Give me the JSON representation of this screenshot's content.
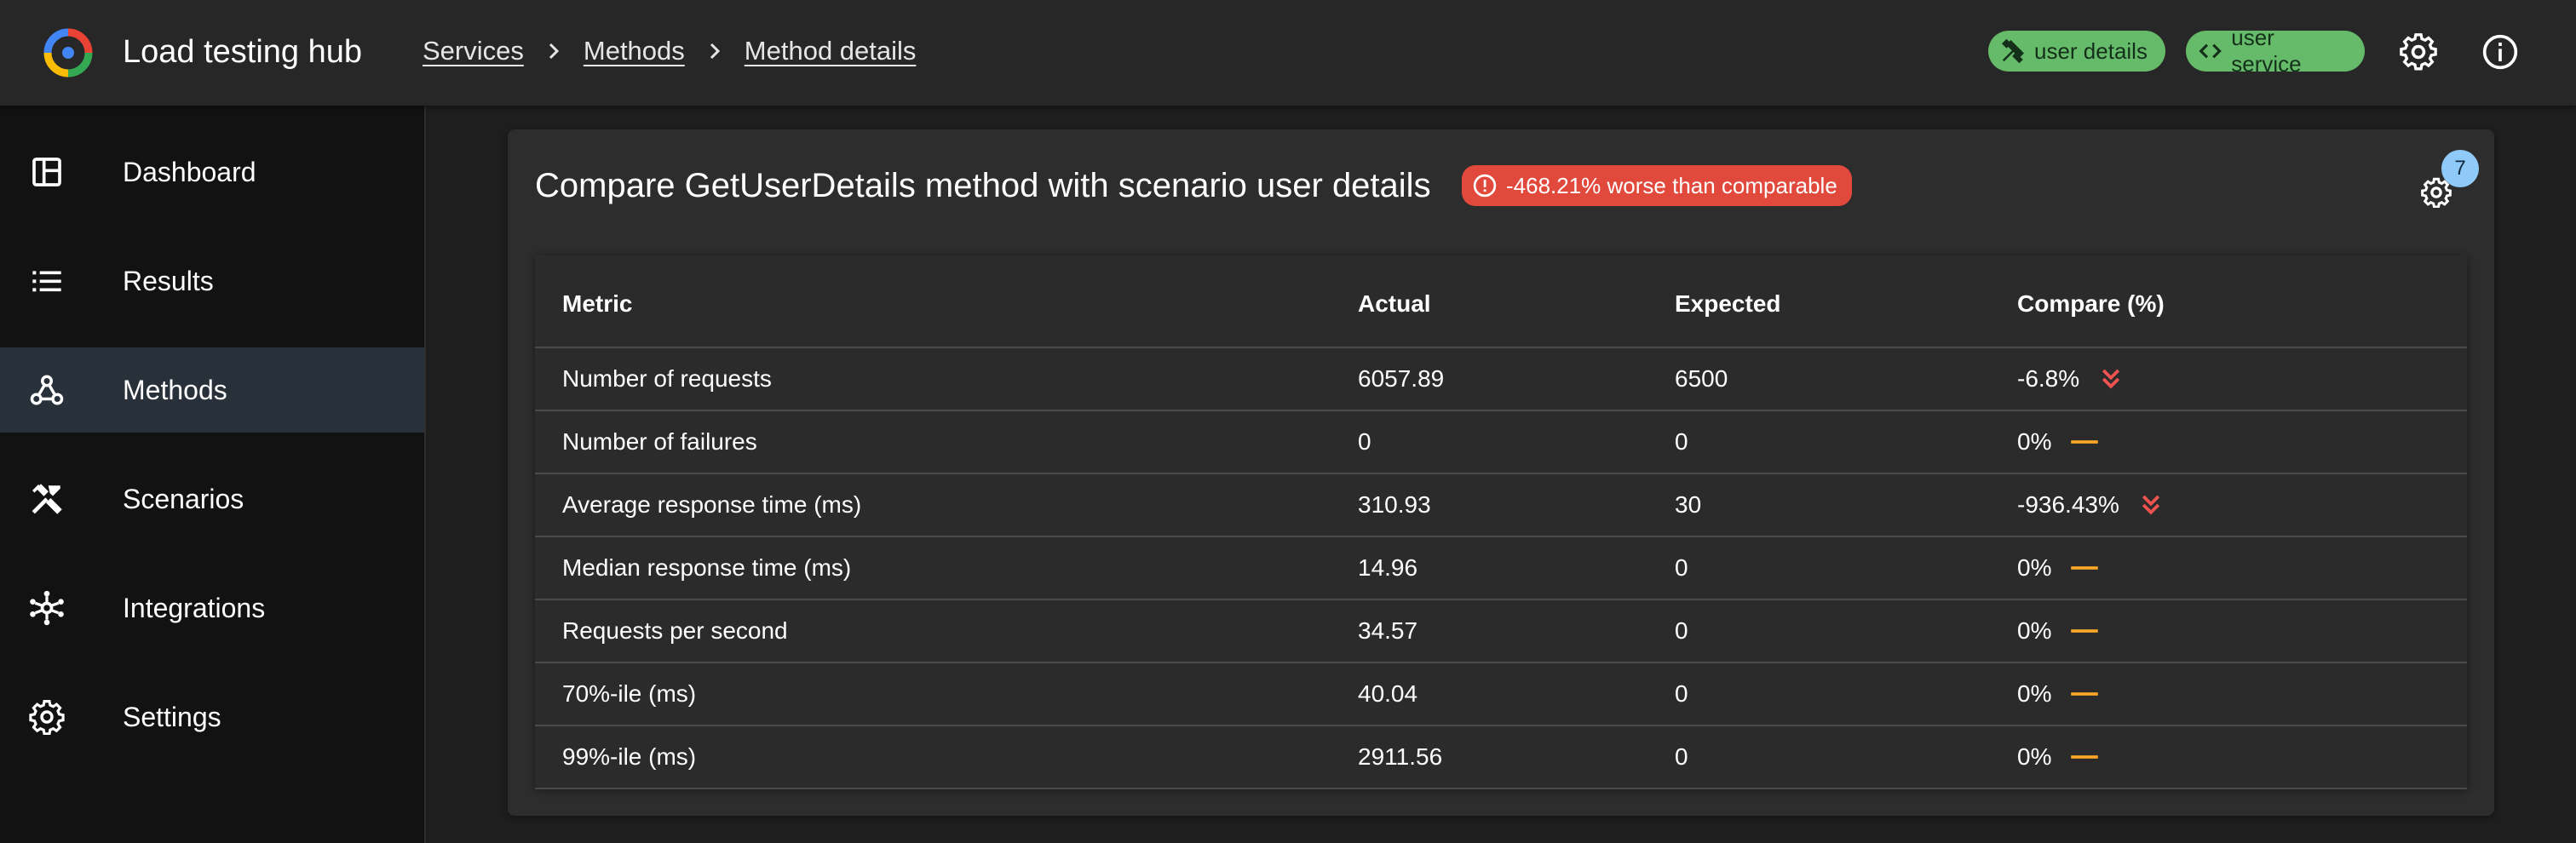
{
  "app": {
    "title": "Load testing hub"
  },
  "breadcrumb": [
    "Services",
    "Methods",
    "Method details"
  ],
  "header_chips": [
    {
      "label": "user details",
      "icon": "tools-icon"
    },
    {
      "label": "user service",
      "icon": "code-icon"
    }
  ],
  "header_icons": [
    "settings-icon",
    "info-icon"
  ],
  "sidebar": {
    "items": [
      {
        "label": "Dashboard",
        "icon": "dashboard-icon"
      },
      {
        "label": "Results",
        "icon": "list-icon"
      },
      {
        "label": "Methods",
        "icon": "webhook-icon",
        "active": true
      },
      {
        "label": "Scenarios",
        "icon": "tools-icon"
      },
      {
        "label": "Integrations",
        "icon": "hub-icon"
      },
      {
        "label": "Settings",
        "icon": "gear-icon"
      }
    ]
  },
  "card": {
    "title": "Compare GetUserDetails method with scenario user details",
    "status_badge": "-468.21% worse than comparable",
    "settings_count": "7"
  },
  "table": {
    "columns": [
      "Metric",
      "Actual",
      "Expected",
      "Compare (%)"
    ],
    "rows": [
      {
        "metric": "Number of requests",
        "actual": "6057.89",
        "expected": "6500",
        "compare": "-6.8%",
        "trend": "down"
      },
      {
        "metric": "Number of failures",
        "actual": "0",
        "expected": "0",
        "compare": "0%",
        "trend": "neutral"
      },
      {
        "metric": "Average response time (ms)",
        "actual": "310.93",
        "expected": "30",
        "compare": "-936.43%",
        "trend": "down"
      },
      {
        "metric": "Median response time (ms)",
        "actual": "14.96",
        "expected": "0",
        "compare": "0%",
        "trend": "neutral"
      },
      {
        "metric": "Requests per second",
        "actual": "34.57",
        "expected": "0",
        "compare": "0%",
        "trend": "neutral"
      },
      {
        "metric": "70%-ile (ms)",
        "actual": "40.04",
        "expected": "0",
        "compare": "0%",
        "trend": "neutral"
      },
      {
        "metric": "99%-ile (ms)",
        "actual": "2911.56",
        "expected": "0",
        "compare": "0%",
        "trend": "neutral"
      }
    ]
  },
  "colors": {
    "accent_green": "#66bb6a",
    "error_red": "#e0493c",
    "trend_down": "#ef5350",
    "trend_neutral": "#ffa726",
    "count_badge": "#90caf9",
    "active_nav": "#283039"
  }
}
